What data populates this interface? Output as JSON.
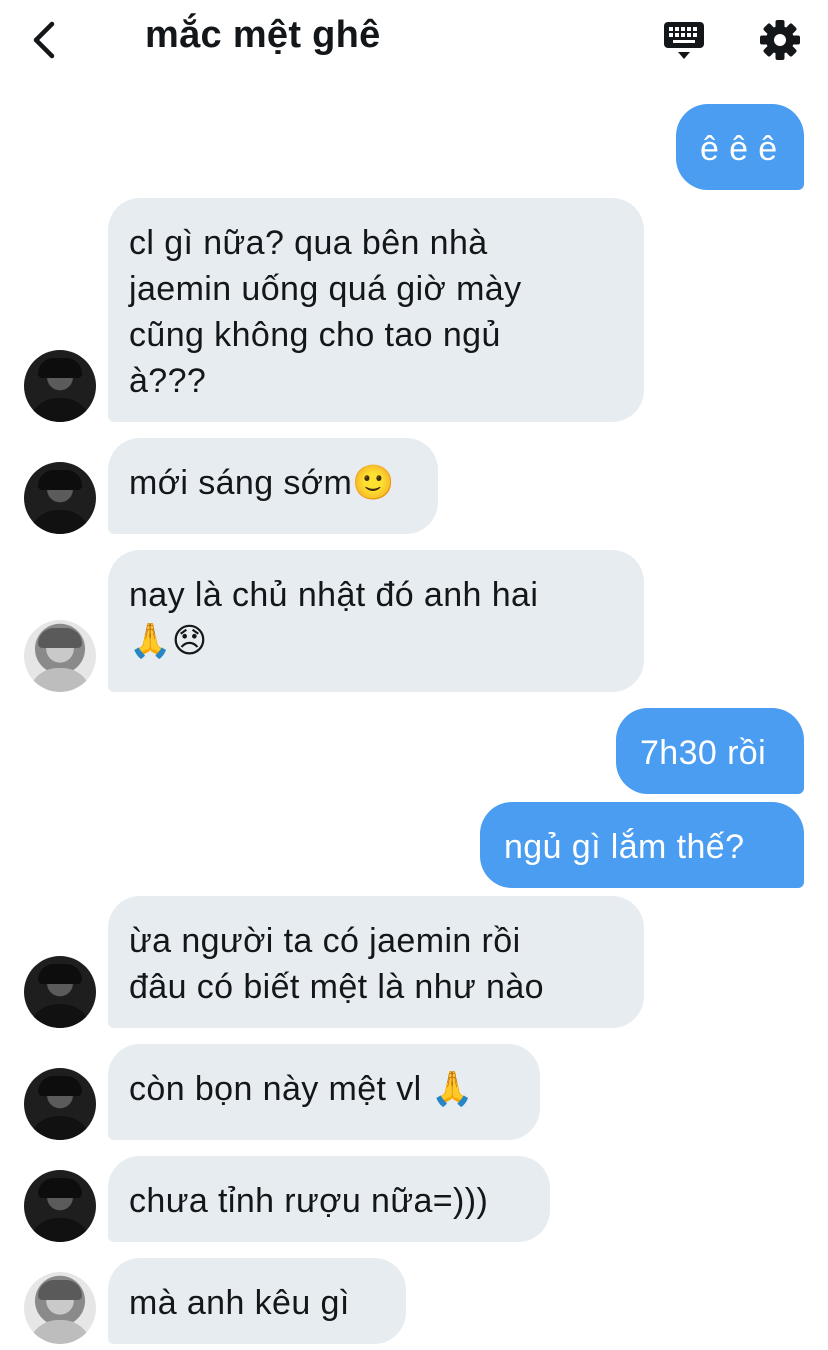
{
  "header": {
    "title": "mắc mệt ghê"
  },
  "colors": {
    "incoming_bubble": "#e6ecf0",
    "outgoing_bubble": "#4a9df0",
    "text": "#14171a"
  },
  "icons": {
    "back": "back-arrow-icon",
    "keyboard": "keyboard-icon",
    "settings": "gear-icon"
  },
  "messages": [
    {
      "direction": "out",
      "text": "ê ê ê"
    },
    {
      "direction": "in",
      "avatar": "dark",
      "text": "cl gì nữa? qua bên nhà\njaemin uống quá giờ mày\ncũng không cho tao ngủ\nà???"
    },
    {
      "direction": "in",
      "avatar": "dark",
      "text": "mới sáng sớm🙂"
    },
    {
      "direction": "in",
      "avatar": "light",
      "text": "nay là chủ nhật đó anh hai\n🙏😞"
    },
    {
      "direction": "out",
      "text": "7h30 rồi"
    },
    {
      "direction": "out",
      "text": "ngủ gì lắm thế?"
    },
    {
      "direction": "in",
      "avatar": "dark",
      "text": "ừa người ta có jaemin rồi\nđâu có biết mệt là như nào"
    },
    {
      "direction": "in",
      "avatar": "dark",
      "text": "còn bọn này mệt vl 🙏"
    },
    {
      "direction": "in",
      "avatar": "dark",
      "text": "chưa tỉnh rượu nữa=)))"
    },
    {
      "direction": "in",
      "avatar": "light",
      "text": "mà anh kêu gì"
    }
  ]
}
